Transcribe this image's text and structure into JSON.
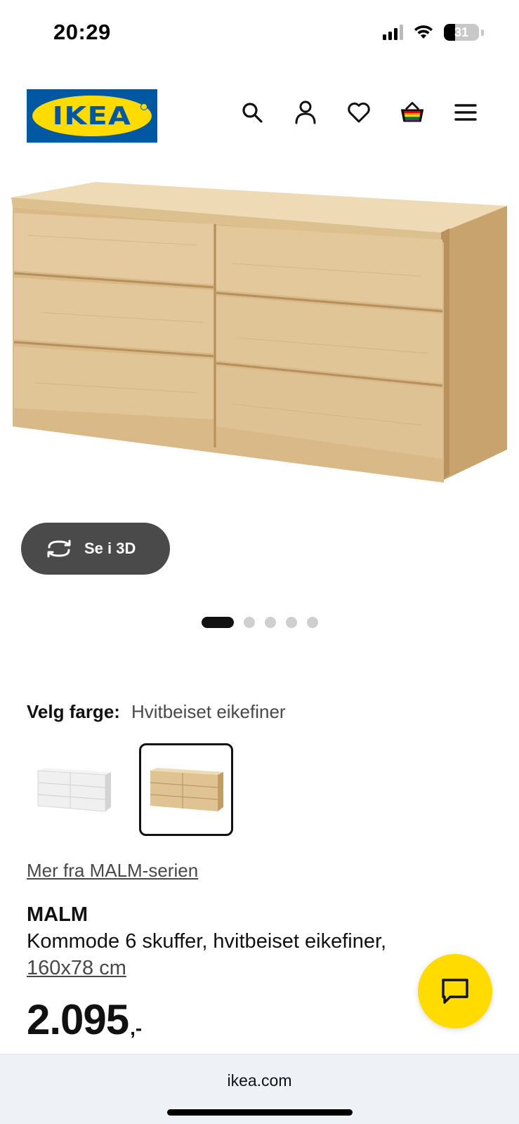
{
  "status_bar": {
    "time": "20:29",
    "battery_level": "31",
    "icons": [
      "signal-icon",
      "wifi-icon",
      "battery-icon"
    ]
  },
  "header": {
    "logo_text": "IKEA",
    "icons": [
      "search-icon",
      "account-icon",
      "heart-icon",
      "cart-icon",
      "menu-icon"
    ]
  },
  "gallery": {
    "view_3d_label": "Se i 3D",
    "slide_count": 5,
    "active_slide": 1
  },
  "color_selector": {
    "label": "Velg farge:",
    "selected_value": "Hvitbeiset eikefiner",
    "options": [
      "white",
      "white-stained-oak"
    ],
    "selected_index": 1
  },
  "series_link": "Mer fra MALM-serien",
  "product": {
    "name": "MALM",
    "description": "Kommode 6 skuffer, hvitbeiset eikefiner,",
    "size": "160x78 cm",
    "price": "2.095",
    "price_suffix": ",-"
  },
  "browser": {
    "url": "ikea.com"
  },
  "colors": {
    "ikea_blue": "#0058a3",
    "ikea_yellow": "#ffdb00",
    "oak": "#e1c99c",
    "button_dark": "#4a4a4a"
  }
}
